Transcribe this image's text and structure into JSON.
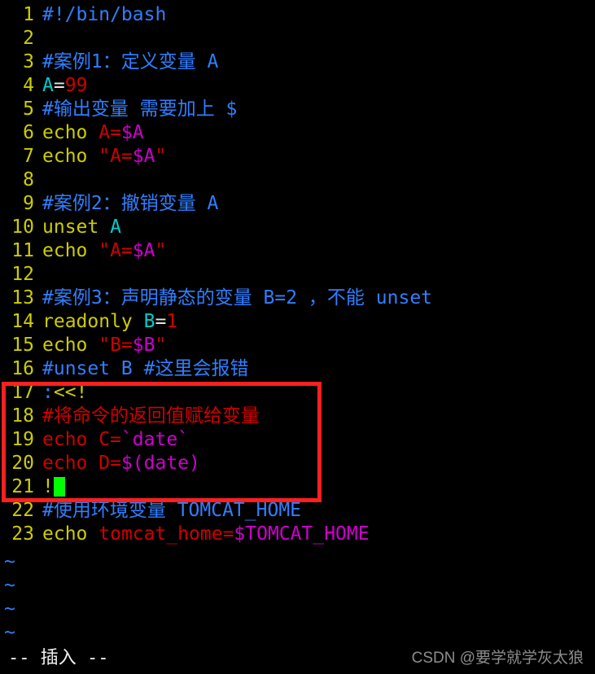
{
  "app": {
    "name": "vim",
    "background": "#000000",
    "mode_text": "-- 插入 --",
    "watermark": "CSDN @要学就学灰太狼"
  },
  "colors": {
    "line_number": "#cdcd00",
    "comment_blue": "#2f7fff",
    "comment_red": "#cf0000",
    "keyword_yellow": "#cdcd00",
    "identifier_cyan": "#00cdcd",
    "operator_white": "#e5e5e5",
    "string_red": "#cd0000",
    "variable_magenta": "#cd00cd",
    "cursor_green": "#00ff00",
    "highlight_box_red": "#ff1f1f",
    "tilde_blue": "#2f7fff",
    "watermark_gray": "#8d8d8d"
  },
  "editor": {
    "lines": [
      {
        "n": "1",
        "spans": [
          {
            "t": "#!/bin/bash",
            "c": "c-comment"
          }
        ]
      },
      {
        "n": "2",
        "spans": []
      },
      {
        "n": "3",
        "spans": [
          {
            "t": "#案例1：定义变量 A",
            "c": "c-comment"
          }
        ]
      },
      {
        "n": "4",
        "spans": [
          {
            "t": "A",
            "c": "c-ident"
          },
          {
            "t": "=",
            "c": "c-op"
          },
          {
            "t": "99",
            "c": "c-num"
          }
        ]
      },
      {
        "n": "5",
        "spans": [
          {
            "t": "#输出变量 需要加上 $",
            "c": "c-comment"
          }
        ]
      },
      {
        "n": "6",
        "spans": [
          {
            "t": "echo ",
            "c": "c-keyword"
          },
          {
            "t": "A=",
            "c": "c-red"
          },
          {
            "t": "$A",
            "c": "c-mag"
          }
        ]
      },
      {
        "n": "7",
        "spans": [
          {
            "t": "echo ",
            "c": "c-keyword"
          },
          {
            "t": "\"A=",
            "c": "c-red"
          },
          {
            "t": "$A",
            "c": "c-mag"
          },
          {
            "t": "\"",
            "c": "c-red"
          }
        ]
      },
      {
        "n": "8",
        "spans": []
      },
      {
        "n": "9",
        "spans": [
          {
            "t": "#案例2：撤销变量 A",
            "c": "c-comment"
          }
        ]
      },
      {
        "n": "10",
        "spans": [
          {
            "t": "unset ",
            "c": "c-keyword"
          },
          {
            "t": "A",
            "c": "c-ident"
          }
        ]
      },
      {
        "n": "11",
        "spans": [
          {
            "t": "echo ",
            "c": "c-keyword"
          },
          {
            "t": "\"A=",
            "c": "c-red"
          },
          {
            "t": "$A",
            "c": "c-mag"
          },
          {
            "t": "\"",
            "c": "c-red"
          }
        ]
      },
      {
        "n": "12",
        "spans": []
      },
      {
        "n": "13",
        "spans": [
          {
            "t": "#案例3：声明静态的变量 B=2 ，不能 unset",
            "c": "c-comment"
          }
        ]
      },
      {
        "n": "14",
        "spans": [
          {
            "t": "readonly ",
            "c": "c-keyword"
          },
          {
            "t": "B",
            "c": "c-ident"
          },
          {
            "t": "=",
            "c": "c-op"
          },
          {
            "t": "1",
            "c": "c-num"
          }
        ]
      },
      {
        "n": "15",
        "spans": [
          {
            "t": "echo ",
            "c": "c-keyword"
          },
          {
            "t": "\"B=",
            "c": "c-red"
          },
          {
            "t": "$B",
            "c": "c-mag"
          },
          {
            "t": "\"",
            "c": "c-red"
          }
        ]
      },
      {
        "n": "16",
        "spans": [
          {
            "t": "#unset B #这里会报错",
            "c": "c-comment"
          }
        ]
      },
      {
        "n": "17",
        "spans": [
          {
            "t": ":",
            "c": "c-spec"
          },
          {
            "t": "<<!",
            "c": "c-keyword"
          }
        ]
      },
      {
        "n": "18",
        "spans": [
          {
            "t": "#将命令的返回值赋给变量",
            "c": "c-comment-r"
          }
        ]
      },
      {
        "n": "19",
        "spans": [
          {
            "t": "echo C=",
            "c": "c-red"
          },
          {
            "t": "`date`",
            "c": "c-mag"
          }
        ]
      },
      {
        "n": "20",
        "spans": [
          {
            "t": "echo D=",
            "c": "c-red"
          },
          {
            "t": "$(date)",
            "c": "c-mag"
          }
        ]
      },
      {
        "n": "21",
        "spans": [
          {
            "t": "!",
            "c": "c-keyword"
          }
        ],
        "cursor": true
      },
      {
        "n": "22",
        "spans": [
          {
            "t": "#使用环境变量 TOMCAT_HOME",
            "c": "c-comment"
          }
        ]
      },
      {
        "n": "23",
        "spans": [
          {
            "t": "echo ",
            "c": "c-keyword"
          },
          {
            "t": "tomcat_home=",
            "c": "c-red"
          },
          {
            "t": "$TOMCAT_HOME",
            "c": "c-mag"
          }
        ]
      }
    ],
    "empty_markers": [
      "~",
      "~",
      "~",
      "~"
    ],
    "highlight_box": {
      "label": "heredoc-highlight",
      "first_line": "17",
      "last_line": "21"
    }
  }
}
